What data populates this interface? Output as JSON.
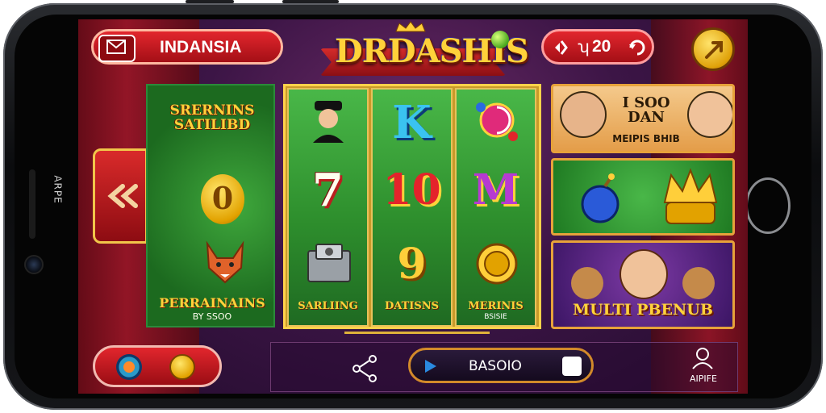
{
  "device": {
    "side_label": "ARPE"
  },
  "header": {
    "region_label": "INDANSIA",
    "logo_text": "DRDASHIS",
    "coins": {
      "label": "ʮ",
      "value": "20"
    }
  },
  "left_card": {
    "title": "SRERNINS SATILIBD",
    "symbol": "0",
    "bottom_title": "PERRAINAINS",
    "bottom_subtitle": "BY SSOO"
  },
  "reels": [
    {
      "top": "portrait",
      "middle": "7",
      "bottom": "slot-machine",
      "caption": "SARLIING",
      "subcaption": ""
    },
    {
      "top": "K",
      "middle": "10",
      "bottom": "9",
      "caption": "DATISNS",
      "subcaption": ""
    },
    {
      "top": "candy",
      "middle": "M",
      "bottom": "coin",
      "caption": "MERINIS",
      "subcaption": "BSISIE"
    }
  ],
  "right_cards": {
    "card1": {
      "title": "I SOO DAN",
      "subtitle": "MEIPIS BHIB"
    },
    "card3": {
      "title": "MULTI PBENUB"
    }
  },
  "footer": {
    "play_label": "BASOIO",
    "profile_label": "AIPIFE"
  },
  "colors": {
    "primary_red": "#d42b2b",
    "gold": "#ffd23a",
    "green": "#2e8f2d",
    "purple_bg": "#3c1546"
  }
}
